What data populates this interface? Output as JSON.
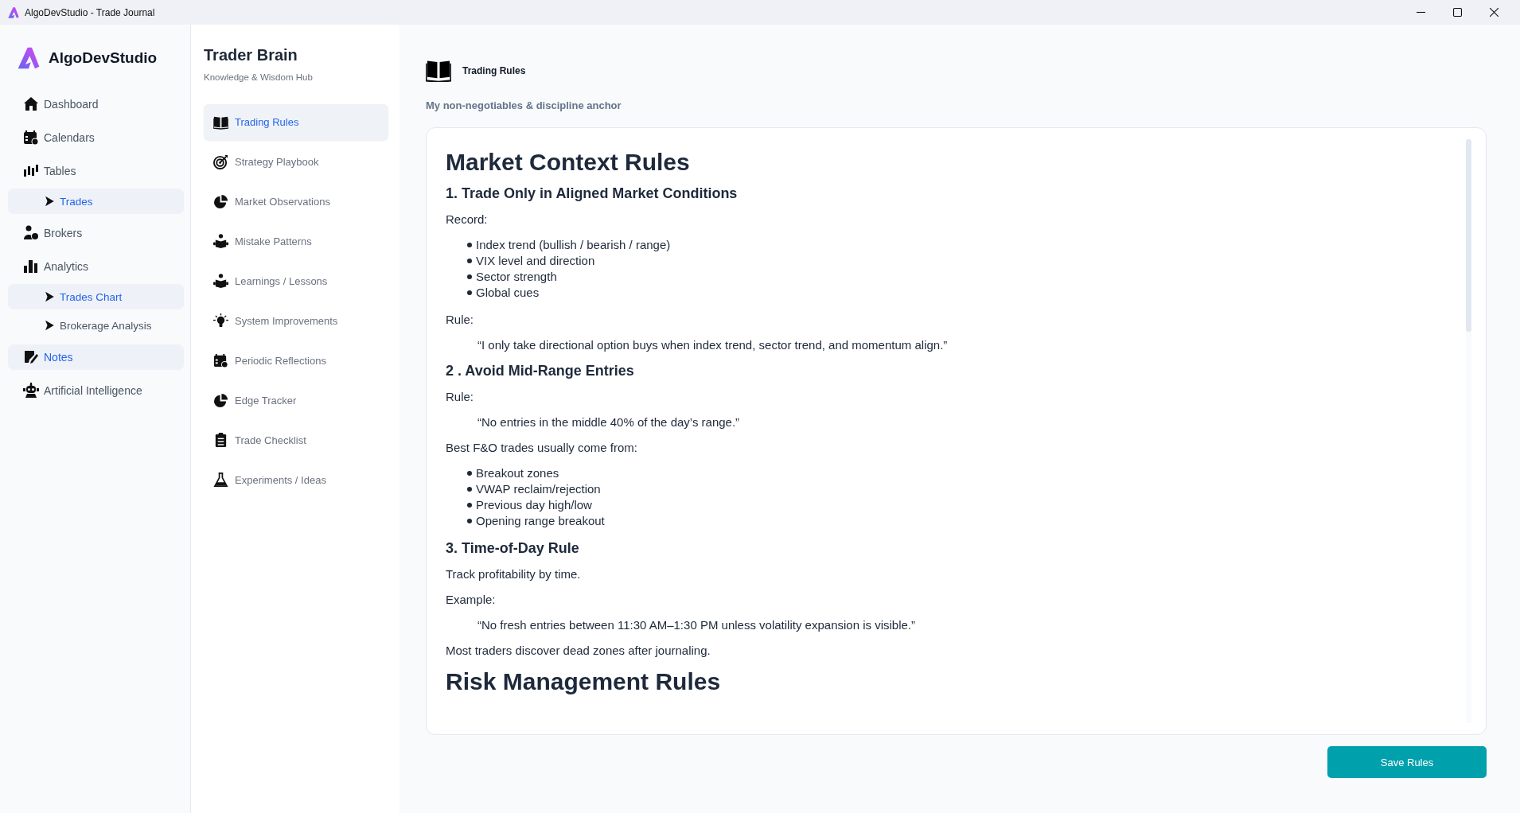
{
  "window": {
    "title": "AlgoDevStudio - Trade Journal"
  },
  "sidebar": {
    "brand": "AlgoDevStudio",
    "items": [
      {
        "label": "Dashboard",
        "selected": false
      },
      {
        "label": "Calendars",
        "selected": false
      },
      {
        "label": "Tables",
        "selected": false,
        "children": [
          {
            "label": "Trades",
            "selected": true
          }
        ]
      },
      {
        "label": "Brokers",
        "selected": false
      },
      {
        "label": "Analytics",
        "selected": false,
        "children": [
          {
            "label": "Trades Chart",
            "selected": true
          },
          {
            "label": "Brokerage Analysis",
            "selected": false
          }
        ]
      },
      {
        "label": "Notes",
        "selected": true
      },
      {
        "label": "Artificial Intelligence",
        "selected": false
      }
    ]
  },
  "brain": {
    "title": "Trader Brain",
    "subtitle": "Knowledge & Wisdom Hub",
    "items": [
      {
        "label": "Trading Rules",
        "selected": true
      },
      {
        "label": "Strategy Playbook",
        "selected": false
      },
      {
        "label": "Market Observations",
        "selected": false
      },
      {
        "label": "Mistake Patterns",
        "selected": false
      },
      {
        "label": "Learnings / Lessons",
        "selected": false
      },
      {
        "label": "System Improvements",
        "selected": false
      },
      {
        "label": "Periodic Reflections",
        "selected": false
      },
      {
        "label": "Edge Tracker",
        "selected": false
      },
      {
        "label": "Trade Checklist",
        "selected": false
      },
      {
        "label": "Experiments / Ideas",
        "selected": false
      }
    ]
  },
  "page": {
    "title": "Trading Rules",
    "subtitle": "My non-negotiables & discipline anchor"
  },
  "editor": {
    "blocks": [
      {
        "kind": "h1",
        "text": "Market Context Rules"
      },
      {
        "kind": "h2",
        "text": "1. Trade Only in Aligned Market Conditions"
      },
      {
        "kind": "p",
        "text": "Record:"
      },
      {
        "kind": "list",
        "items": [
          "Index trend (bullish / bearish / range)",
          "VIX level and direction",
          "Sector strength",
          "Global cues"
        ]
      },
      {
        "kind": "p",
        "text": "Rule:"
      },
      {
        "kind": "quote",
        "text": "“I only take directional option buys when index trend, sector trend, and momentum align.”"
      },
      {
        "kind": "h2",
        "text": "2 . Avoid Mid-Range Entries"
      },
      {
        "kind": "p",
        "text": "Rule:"
      },
      {
        "kind": "quote",
        "text": "“No entries in the middle 40% of the day’s range.”"
      },
      {
        "kind": "p",
        "text": "Best F&O trades usually come from:"
      },
      {
        "kind": "list",
        "items": [
          "Breakout zones",
          "VWAP reclaim/rejection",
          "Previous day high/low",
          "Opening range breakout"
        ]
      },
      {
        "kind": "h2",
        "text": "3. Time-of-Day Rule"
      },
      {
        "kind": "p",
        "text": "Track profitability by time."
      },
      {
        "kind": "p",
        "text": "Example:"
      },
      {
        "kind": "quote",
        "text": "“No fresh entries between 11:30 AM–1:30 PM unless volatility expansion is visible.”"
      },
      {
        "kind": "p",
        "text": "Most traders discover dead zones after journaling."
      },
      {
        "kind": "h1",
        "text": "Risk Management Rules"
      }
    ]
  },
  "save_button": "Save Rules"
}
